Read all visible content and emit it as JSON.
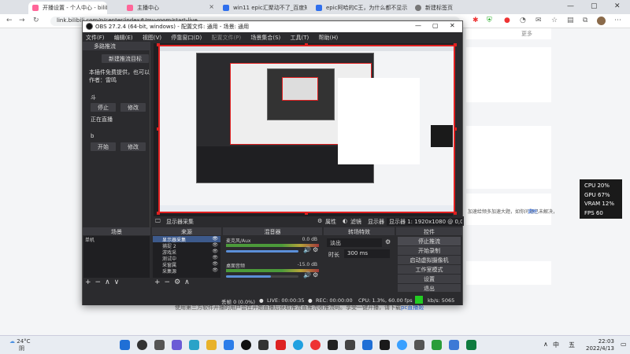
{
  "browser": {
    "tabs": [
      {
        "label": "开播设置 - 个人中心 - bilibili link",
        "color": "#ff6699"
      },
      {
        "label": "主播中心",
        "color": "#ff6699"
      },
      {
        "label": "win11 epic汇聚动不了_百度知",
        "color": "#2f6fed"
      },
      {
        "label": "epic阿哈的C王，为什么都不显示",
        "color": "#2f6fed"
      },
      {
        "label": "新建标签页",
        "color": "#777777"
      }
    ],
    "url": "link.bilibili.com/p/center/index#/my-room/start-live",
    "right_links": [
      "更多"
    ]
  },
  "page": {
    "snippets": [
      "把有来推流就行"
    ],
    "advice_prefix": "加速给频多加速大题，如你问题已未解决，",
    "advice_link": "请附",
    "bottom_text": "使用第三方软件开播的用户会在开始直播后获取推流直推流收推流码。享受一键开播，请下载",
    "bottom_link": "pc直播姬"
  },
  "obs": {
    "title": "OBS 27.2.4 (64-bit, windows) - 配置文件: 通用 - 场景: 通用",
    "menu": [
      "文件(F)",
      "编辑(E)",
      "视图(V)",
      "停靠窗口(D)",
      "配置文件(P)",
      "场景集合(S)",
      "工具(T)",
      "帮助(H)"
    ],
    "dock": {
      "tab": "多路推流",
      "new_target_button": "新建推流目标",
      "desc_line1": "本插件免费提供，也可以",
      "desc_line2": "作者：雷鸣",
      "target1_label": "斗",
      "stop_button": "停止",
      "modify_button": "修改",
      "status": "正在直播",
      "target2_label": "b",
      "start_button": "开始",
      "modify_button2": "修改"
    },
    "source_bar": {
      "source": "显示器采集",
      "properties": "属性",
      "filters": "滤镜",
      "display_label": "显示器",
      "display_value": "显示器 1: 1920x1080 @ 0,0 (主显示器)"
    },
    "scenes": {
      "header": "场景",
      "items": [
        "单机"
      ]
    },
    "sources": {
      "header": "来源",
      "items": [
        "显示器采集",
        "捕捉 2",
        "游戏采",
        "测试中",
        "采窗属",
        "采集源"
      ]
    },
    "mixer": {
      "header": "混音器",
      "channels": [
        {
          "name": "麦克风/Aux",
          "db": "0.0 dB",
          "fill": 0.0
        },
        {
          "name": "桌面音频",
          "db": "-15.0 dB",
          "fill": 0.62
        }
      ]
    },
    "transitions": {
      "header": "转场特效",
      "type": "淡出",
      "duration_label": "时长",
      "duration": "300 ms"
    },
    "controls": {
      "header": "控件",
      "buttons": [
        "停止推流",
        "开始录制",
        "启动虚拟摄像机",
        "工作室模式",
        "设置",
        "退出"
      ]
    },
    "status": {
      "dropped": "丢帧 0 (0.0%)",
      "live": "LIVE: 00:00:35",
      "rec": "REC: 00:00:00",
      "cpu": "CPU: 1.3%, 60.00 fps",
      "kbs": "kb/s: 5065"
    }
  },
  "overlay": {
    "lines": [
      "CPU 20%",
      "GPU 67%",
      "VRAM 12%",
      "FPS 60"
    ]
  },
  "taskbar": {
    "weather_temp": "24°C",
    "weather_desc": "阴",
    "time": "22:03",
    "date": "2022/4/13",
    "ime": "中",
    "weekday": "五"
  },
  "colors": {
    "accent_red": "#e02020",
    "bili_pink": "#ff6699",
    "live_green": "#22cc22"
  }
}
